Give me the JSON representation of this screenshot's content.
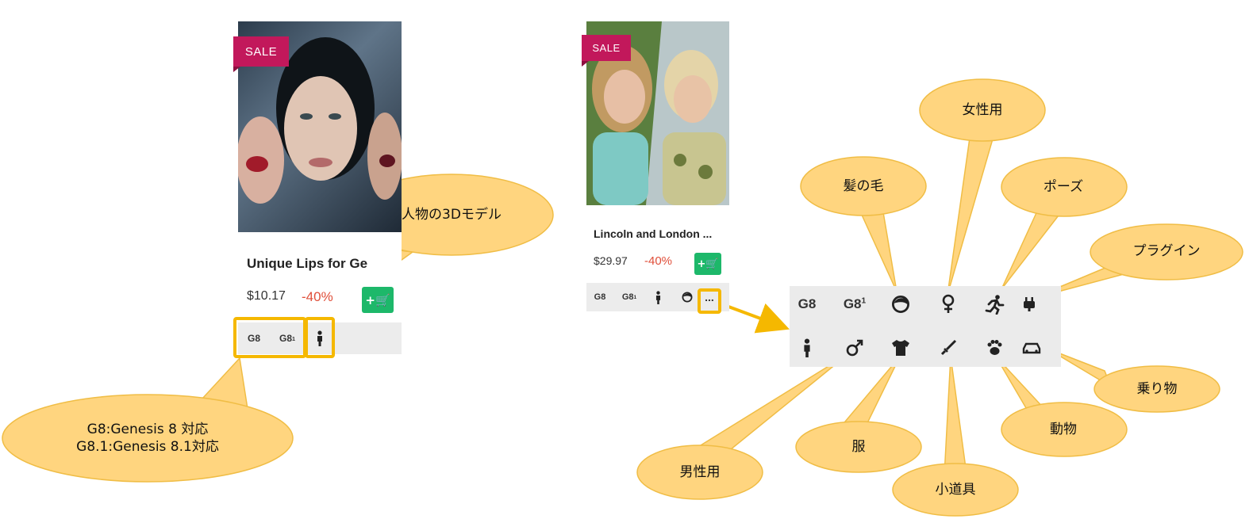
{
  "card1": {
    "sale": "SALE",
    "title": "Unique Lips for Ge",
    "price": "$10.17",
    "discount": "-40%",
    "cart": "+🛒",
    "tags": [
      "G8",
      "G8",
      "1"
    ]
  },
  "card2": {
    "sale": "SALE",
    "title": "Lincoln and London ...",
    "price": "$29.97",
    "discount": "-40%",
    "cart": "+🛒",
    "tags": [
      "G8",
      "G8",
      "1"
    ],
    "more": "..."
  },
  "legend": {
    "g8": "G8",
    "g81": "G8",
    "g81_sup": "1",
    "icons": [
      "hair-icon",
      "female-icon",
      "running-pose-icon",
      "plugin-icon",
      "person-icon",
      "male-icon",
      "tshirt-icon",
      "sword-icon",
      "paw-icon",
      "car-icon"
    ]
  },
  "callouts": {
    "genesis_line1": "G8:Genesis  8 対応",
    "genesis_line2": "G8.1:Genesis  8.1対応",
    "person_3d": "人物の3Dモデル",
    "hair": "髪の毛",
    "female": "女性用",
    "pose": "ポーズ",
    "plugin": "プラグイン",
    "vehicle": "乗り物",
    "animal": "動物",
    "props": "小道具",
    "clothes": "服",
    "male": "男性用"
  },
  "colors": {
    "sale": "#c2185b",
    "cart": "#1db86a",
    "discount": "#e04f3a",
    "highlight": "#f5b800",
    "bubble_fill": "#ffd57f",
    "bubble_stroke": "#f0bd45"
  }
}
